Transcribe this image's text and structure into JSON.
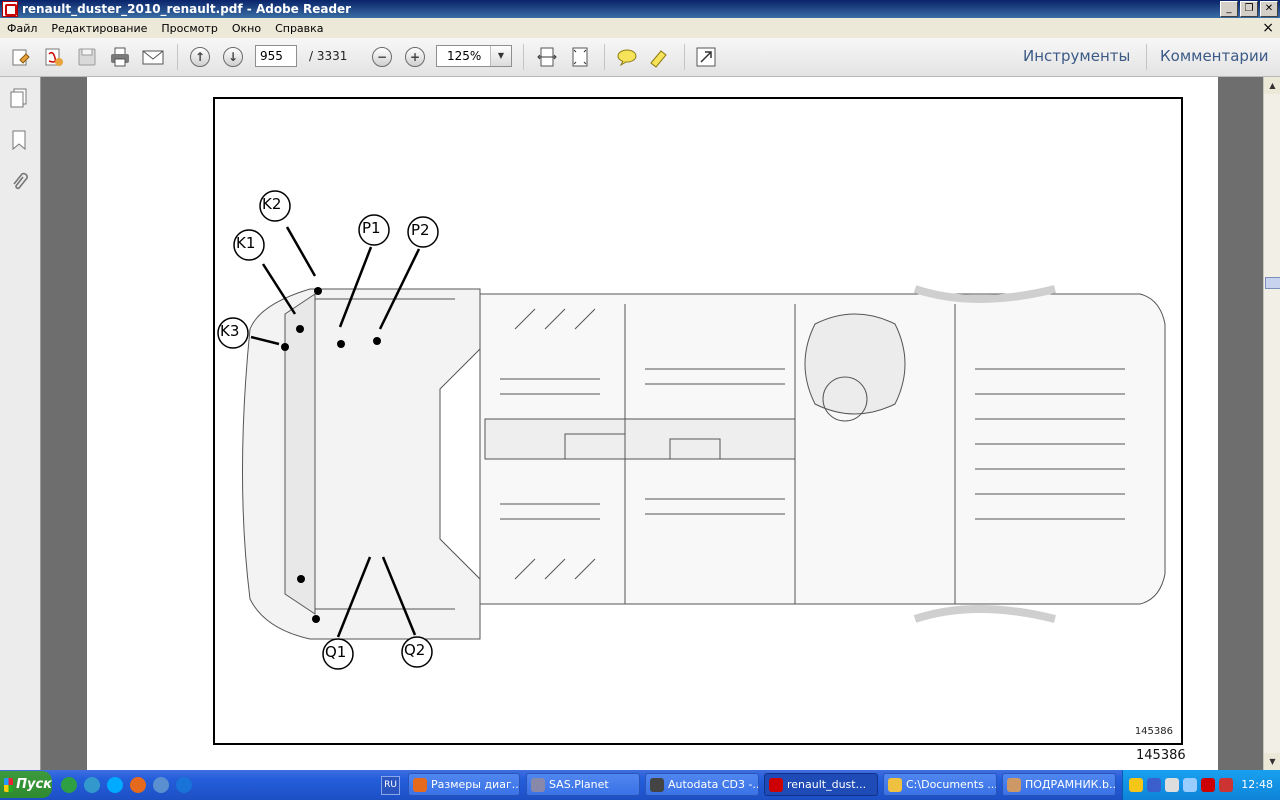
{
  "window": {
    "title": "renault_duster_2010_renault.pdf - Adobe Reader",
    "buttons": [
      "_",
      "❐",
      "✕"
    ]
  },
  "menu": {
    "items": [
      "Файл",
      "Редактирование",
      "Просмотр",
      "Окно",
      "Справка"
    ],
    "close": "×"
  },
  "toolbar": {
    "page_current": "955",
    "page_total": "/ 3331",
    "zoom": "125%",
    "tools_label": "Инструменты",
    "comments_label": "Комментарии"
  },
  "figure": {
    "labels": [
      "K2",
      "K1",
      "K3",
      "P1",
      "P2",
      "Q1",
      "Q2"
    ],
    "inner_number": "145386",
    "caption": "145386"
  },
  "taskbar": {
    "start": "Пуск",
    "language": "RU",
    "tasks": [
      "Размеры диаг...",
      "SAS.Planet",
      "Autodata CD3 -...",
      "renault_dust...",
      "C:\\Documents ...",
      "ПОДРАМНИК.b..."
    ],
    "clock": "12:48"
  },
  "colors": {
    "titlebar": "#0a246a",
    "taskbar": "#245edb",
    "toolbar_link": "#3c5a86"
  }
}
